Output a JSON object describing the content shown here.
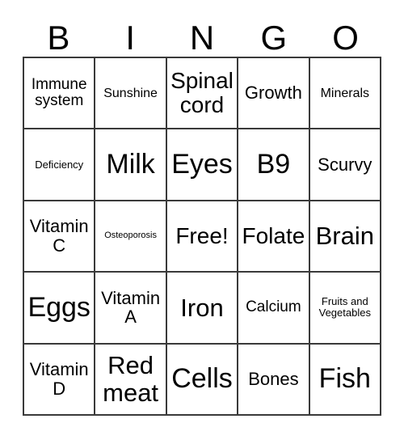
{
  "card": {
    "type": "bingo-card",
    "columns": 5,
    "rows": 5,
    "border_color": "#3a3a3a",
    "background_color": "#ffffff",
    "text_color": "#000000"
  },
  "header": {
    "letters": [
      "B",
      "I",
      "N",
      "G",
      "O"
    ]
  },
  "grid": {
    "rows": [
      [
        {
          "text": "Immune system",
          "size": "sm"
        },
        {
          "text": "Sunshine",
          "size": "xs"
        },
        {
          "text": "Spinal cord",
          "size": "lg"
        },
        {
          "text": "Growth",
          "size": "md"
        },
        {
          "text": "Minerals",
          "size": "xs"
        }
      ],
      [
        {
          "text": "Deficiency",
          "size": "xxs"
        },
        {
          "text": "Milk",
          "size": "xxl"
        },
        {
          "text": "Eyes",
          "size": "xxl"
        },
        {
          "text": "B9",
          "size": "xxl"
        },
        {
          "text": "Scurvy",
          "size": "md"
        }
      ],
      [
        {
          "text": "Vitamin C",
          "size": "md"
        },
        {
          "text": "Osteoporosis",
          "size": "tiny"
        },
        {
          "text": "Free!",
          "size": "lg"
        },
        {
          "text": "Folate",
          "size": "lg"
        },
        {
          "text": "Brain",
          "size": "xl"
        }
      ],
      [
        {
          "text": "Eggs",
          "size": "xxl"
        },
        {
          "text": "Vitamin A",
          "size": "md"
        },
        {
          "text": "Iron",
          "size": "xl"
        },
        {
          "text": "Calcium",
          "size": "sm"
        },
        {
          "text": "Fruits and Vegetables",
          "size": "xxs"
        }
      ],
      [
        {
          "text": "Vitamin D",
          "size": "md"
        },
        {
          "text": "Red meat",
          "size": "xl"
        },
        {
          "text": "Cells",
          "size": "xxl"
        },
        {
          "text": "Bones",
          "size": "md"
        },
        {
          "text": "Fish",
          "size": "xxl"
        }
      ]
    ]
  }
}
